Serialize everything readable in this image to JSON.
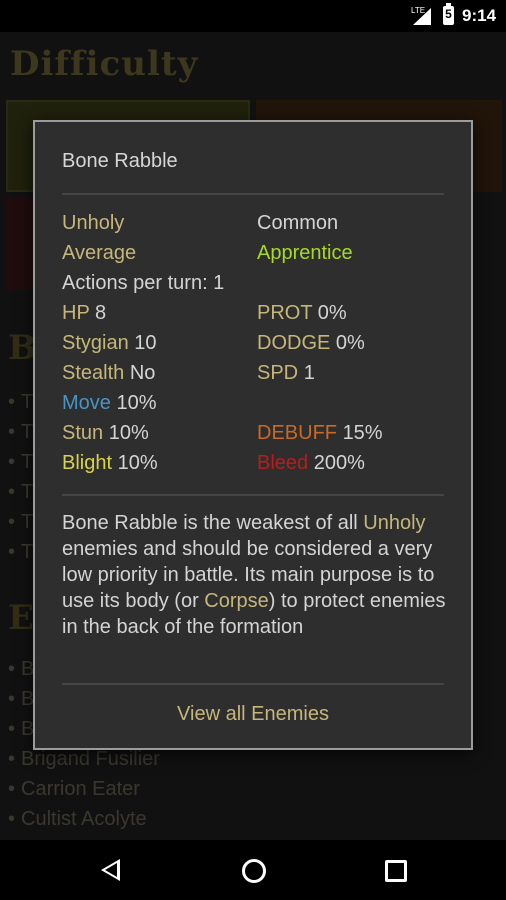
{
  "status_bar": {
    "network": "LTE",
    "battery": "5",
    "time": "9:14"
  },
  "background": {
    "title": "Difficulty",
    "section2_heading": "Bo",
    "section2_items": [
      "T",
      "T",
      "T",
      "T",
      "T",
      "T"
    ],
    "section3_heading": "En",
    "section3_items": [
      "B",
      "B",
      "B",
      "Brigand Fusilier",
      "Carrion Eater",
      "Cultist Acolyte"
    ]
  },
  "dialog": {
    "title": "Bone Rabble",
    "type": "Unholy",
    "rarity": "Common",
    "size_class": "Average",
    "level": "Apprentice",
    "actions": "Actions per turn: 1",
    "hp": {
      "label": "HP",
      "value": "8"
    },
    "prot": {
      "label": "PROT",
      "value": "0%"
    },
    "stygian": {
      "label": "Stygian",
      "value": "10"
    },
    "dodge": {
      "label": "DODGE",
      "value": "0%"
    },
    "stealth": {
      "label": "Stealth",
      "value": "No"
    },
    "spd": {
      "label": "SPD",
      "value": "1"
    },
    "move": {
      "label": "Move",
      "value": "10%"
    },
    "stun": {
      "label": "Stun",
      "value": "10%"
    },
    "debuff": {
      "label": "DEBUFF",
      "value": "15%"
    },
    "blight": {
      "label": "Blight",
      "value": "10%"
    },
    "bleed": {
      "label": "Bleed",
      "value": "200%"
    },
    "description": {
      "p1": "Bone Rabble is the weakest of all ",
      "h1": "Unholy",
      "p2": " enemies and should be considered a very low priority in battle. Its main purpose is to use its body (or ",
      "h2": "Corpse",
      "p3": ") to protect enemies in the back of the formation"
    },
    "view_all_label": "View all Enemies"
  },
  "colors": {
    "key": "#c6b67a",
    "level": "#a6d92a",
    "move": "#4a94c4",
    "debuff": "#c96a26",
    "blight": "#d9d24a",
    "bleed": "#b81d1d"
  }
}
